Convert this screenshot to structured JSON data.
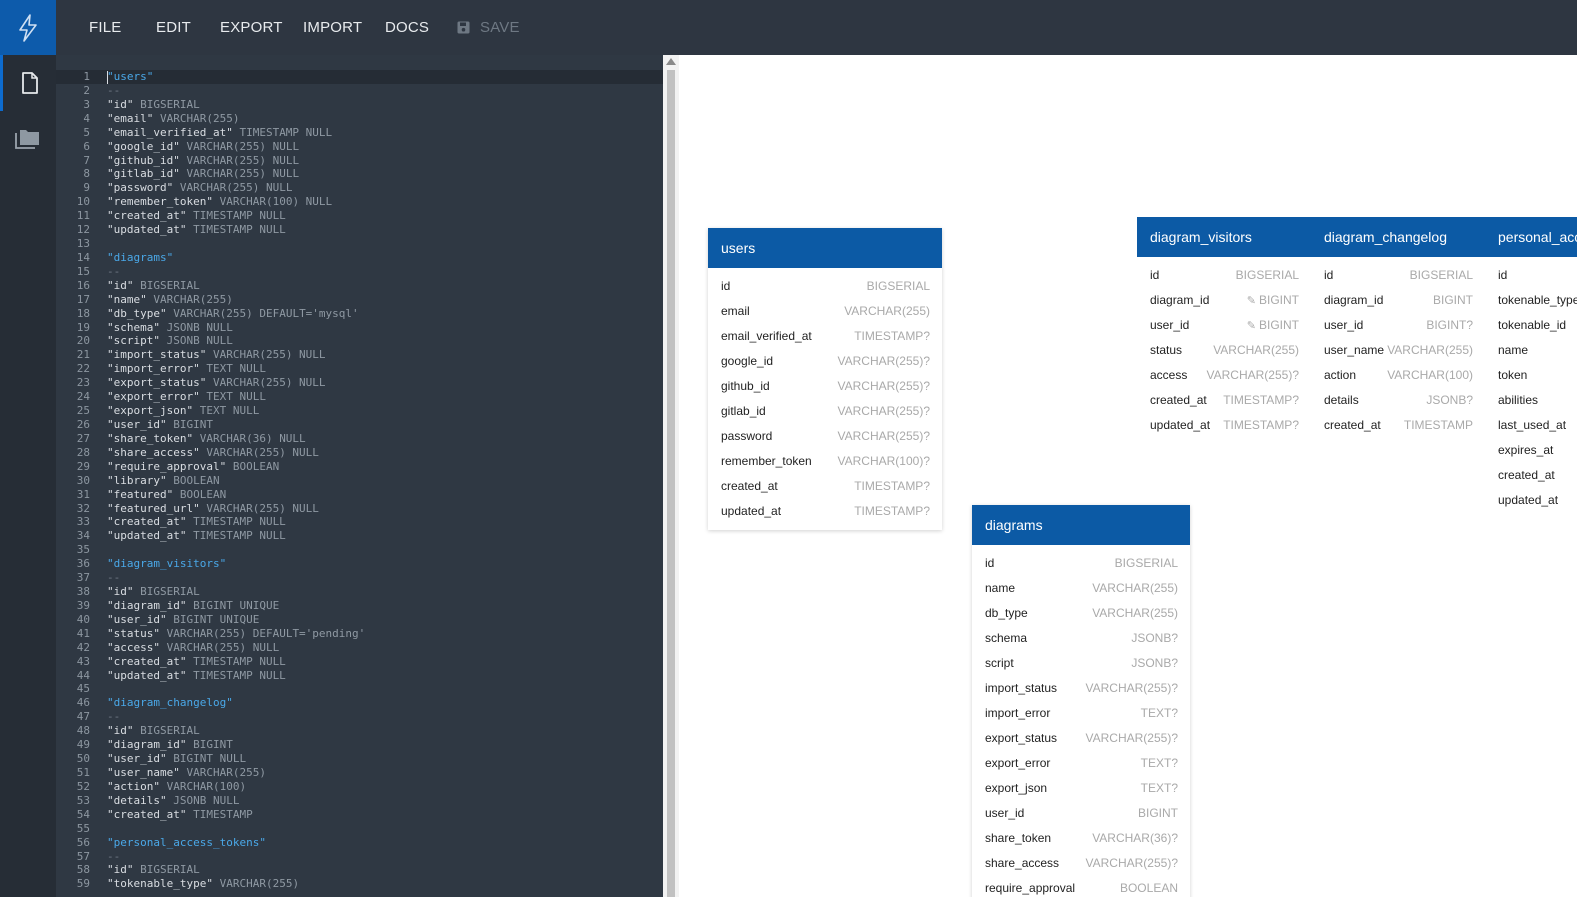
{
  "menu": {
    "file": "FILE",
    "edit": "EDIT",
    "export": "EXPORT",
    "import": "IMPORT",
    "docs": "DOCS",
    "save": "SAVE"
  },
  "sidebar": {
    "items": [
      {
        "icon": "file-icon",
        "active": true
      },
      {
        "icon": "folder-icon",
        "active": false
      }
    ]
  },
  "editor": {
    "lines": [
      [
        {
          "c": "tbl",
          "t": "\"users\""
        }
      ],
      [
        {
          "c": "dash",
          "t": "--"
        }
      ],
      [
        {
          "c": "n",
          "t": "\"id\" "
        },
        {
          "c": "t",
          "t": "BIGSERIAL"
        }
      ],
      [
        {
          "c": "n",
          "t": "\"email\" "
        },
        {
          "c": "t",
          "t": "VARCHAR(255)"
        }
      ],
      [
        {
          "c": "n",
          "t": "\"email_verified_at\" "
        },
        {
          "c": "t",
          "t": "TIMESTAMP NULL"
        }
      ],
      [
        {
          "c": "n",
          "t": "\"google_id\" "
        },
        {
          "c": "t",
          "t": "VARCHAR(255) NULL"
        }
      ],
      [
        {
          "c": "n",
          "t": "\"github_id\" "
        },
        {
          "c": "t",
          "t": "VARCHAR(255) NULL"
        }
      ],
      [
        {
          "c": "n",
          "t": "\"gitlab_id\" "
        },
        {
          "c": "t",
          "t": "VARCHAR(255) NULL"
        }
      ],
      [
        {
          "c": "n",
          "t": "\"password\" "
        },
        {
          "c": "t",
          "t": "VARCHAR(255) NULL"
        }
      ],
      [
        {
          "c": "n",
          "t": "\"remember_token\" "
        },
        {
          "c": "t",
          "t": "VARCHAR(100) NULL"
        }
      ],
      [
        {
          "c": "n",
          "t": "\"created_at\" "
        },
        {
          "c": "t",
          "t": "TIMESTAMP NULL"
        }
      ],
      [
        {
          "c": "n",
          "t": "\"updated_at\" "
        },
        {
          "c": "t",
          "t": "TIMESTAMP NULL"
        }
      ],
      [],
      [
        {
          "c": "tbl",
          "t": "\"diagrams\""
        }
      ],
      [
        {
          "c": "dash",
          "t": "--"
        }
      ],
      [
        {
          "c": "n",
          "t": "\"id\" "
        },
        {
          "c": "t",
          "t": "BIGSERIAL"
        }
      ],
      [
        {
          "c": "n",
          "t": "\"name\" "
        },
        {
          "c": "t",
          "t": "VARCHAR(255)"
        }
      ],
      [
        {
          "c": "n",
          "t": "\"db_type\" "
        },
        {
          "c": "t",
          "t": "VARCHAR(255) DEFAULT='mysql'"
        }
      ],
      [
        {
          "c": "n",
          "t": "\"schema\" "
        },
        {
          "c": "t",
          "t": "JSONB NULL"
        }
      ],
      [
        {
          "c": "n",
          "t": "\"script\" "
        },
        {
          "c": "t",
          "t": "JSONB NULL"
        }
      ],
      [
        {
          "c": "n",
          "t": "\"import_status\" "
        },
        {
          "c": "t",
          "t": "VARCHAR(255) NULL"
        }
      ],
      [
        {
          "c": "n",
          "t": "\"import_error\" "
        },
        {
          "c": "t",
          "t": "TEXT NULL"
        }
      ],
      [
        {
          "c": "n",
          "t": "\"export_status\" "
        },
        {
          "c": "t",
          "t": "VARCHAR(255) NULL"
        }
      ],
      [
        {
          "c": "n",
          "t": "\"export_error\" "
        },
        {
          "c": "t",
          "t": "TEXT NULL"
        }
      ],
      [
        {
          "c": "n",
          "t": "\"export_json\" "
        },
        {
          "c": "t",
          "t": "TEXT NULL"
        }
      ],
      [
        {
          "c": "n",
          "t": "\"user_id\" "
        },
        {
          "c": "t",
          "t": "BIGINT"
        }
      ],
      [
        {
          "c": "n",
          "t": "\"share_token\" "
        },
        {
          "c": "t",
          "t": "VARCHAR(36) NULL"
        }
      ],
      [
        {
          "c": "n",
          "t": "\"share_access\" "
        },
        {
          "c": "t",
          "t": "VARCHAR(255) NULL"
        }
      ],
      [
        {
          "c": "n",
          "t": "\"require_approval\" "
        },
        {
          "c": "t",
          "t": "BOOLEAN"
        }
      ],
      [
        {
          "c": "n",
          "t": "\"library\" "
        },
        {
          "c": "t",
          "t": "BOOLEAN"
        }
      ],
      [
        {
          "c": "n",
          "t": "\"featured\" "
        },
        {
          "c": "t",
          "t": "BOOLEAN"
        }
      ],
      [
        {
          "c": "n",
          "t": "\"featured_url\" "
        },
        {
          "c": "t",
          "t": "VARCHAR(255) NULL"
        }
      ],
      [
        {
          "c": "n",
          "t": "\"created_at\" "
        },
        {
          "c": "t",
          "t": "TIMESTAMP NULL"
        }
      ],
      [
        {
          "c": "n",
          "t": "\"updated_at\" "
        },
        {
          "c": "t",
          "t": "TIMESTAMP NULL"
        }
      ],
      [],
      [
        {
          "c": "tbl",
          "t": "\"diagram_visitors\""
        }
      ],
      [
        {
          "c": "dash",
          "t": "--"
        }
      ],
      [
        {
          "c": "n",
          "t": "\"id\" "
        },
        {
          "c": "t",
          "t": "BIGSERIAL"
        }
      ],
      [
        {
          "c": "n",
          "t": "\"diagram_id\" "
        },
        {
          "c": "t",
          "t": "BIGINT UNIQUE"
        }
      ],
      [
        {
          "c": "n",
          "t": "\"user_id\" "
        },
        {
          "c": "t",
          "t": "BIGINT UNIQUE"
        }
      ],
      [
        {
          "c": "n",
          "t": "\"status\" "
        },
        {
          "c": "t",
          "t": "VARCHAR(255) DEFAULT='pending'"
        }
      ],
      [
        {
          "c": "n",
          "t": "\"access\" "
        },
        {
          "c": "t",
          "t": "VARCHAR(255) NULL"
        }
      ],
      [
        {
          "c": "n",
          "t": "\"created_at\" "
        },
        {
          "c": "t",
          "t": "TIMESTAMP NULL"
        }
      ],
      [
        {
          "c": "n",
          "t": "\"updated_at\" "
        },
        {
          "c": "t",
          "t": "TIMESTAMP NULL"
        }
      ],
      [],
      [
        {
          "c": "tbl",
          "t": "\"diagram_changelog\""
        }
      ],
      [
        {
          "c": "dash",
          "t": "--"
        }
      ],
      [
        {
          "c": "n",
          "t": "\"id\" "
        },
        {
          "c": "t",
          "t": "BIGSERIAL"
        }
      ],
      [
        {
          "c": "n",
          "t": "\"diagram_id\" "
        },
        {
          "c": "t",
          "t": "BIGINT"
        }
      ],
      [
        {
          "c": "n",
          "t": "\"user_id\" "
        },
        {
          "c": "t",
          "t": "BIGINT NULL"
        }
      ],
      [
        {
          "c": "n",
          "t": "\"user_name\" "
        },
        {
          "c": "t",
          "t": "VARCHAR(255)"
        }
      ],
      [
        {
          "c": "n",
          "t": "\"action\" "
        },
        {
          "c": "t",
          "t": "VARCHAR(100)"
        }
      ],
      [
        {
          "c": "n",
          "t": "\"details\" "
        },
        {
          "c": "t",
          "t": "JSONB NULL"
        }
      ],
      [
        {
          "c": "n",
          "t": "\"created_at\" "
        },
        {
          "c": "t",
          "t": "TIMESTAMP"
        }
      ],
      [],
      [
        {
          "c": "tbl",
          "t": "\"personal_access_tokens\""
        }
      ],
      [
        {
          "c": "dash",
          "t": "--"
        }
      ],
      [
        {
          "c": "n",
          "t": "\"id\" "
        },
        {
          "c": "t",
          "t": "BIGSERIAL"
        }
      ],
      [
        {
          "c": "n",
          "t": "\"tokenable_type\" "
        },
        {
          "c": "t",
          "t": "VARCHAR(255)"
        }
      ]
    ]
  },
  "diagram": {
    "tables": [
      {
        "name": "users",
        "columns": [
          {
            "name": "id",
            "type": "BIGSERIAL"
          },
          {
            "name": "email",
            "type": "VARCHAR(255)"
          },
          {
            "name": "email_verified_at",
            "type": "TIMESTAMP?"
          },
          {
            "name": "google_id",
            "type": "VARCHAR(255)?"
          },
          {
            "name": "github_id",
            "type": "VARCHAR(255)?"
          },
          {
            "name": "gitlab_id",
            "type": "VARCHAR(255)?"
          },
          {
            "name": "password",
            "type": "VARCHAR(255)?"
          },
          {
            "name": "remember_token",
            "type": "VARCHAR(100)?"
          },
          {
            "name": "created_at",
            "type": "TIMESTAMP?"
          },
          {
            "name": "updated_at",
            "type": "TIMESTAMP?"
          }
        ]
      },
      {
        "name": "diagram_visitors",
        "columns": [
          {
            "name": "id",
            "type": "BIGSERIAL"
          },
          {
            "name": "diagram_id",
            "type": "BIGINT",
            "key": true
          },
          {
            "name": "user_id",
            "type": "BIGINT",
            "key": true
          },
          {
            "name": "status",
            "type": "VARCHAR(255)"
          },
          {
            "name": "access",
            "type": "VARCHAR(255)?"
          },
          {
            "name": "created_at",
            "type": "TIMESTAMP?"
          },
          {
            "name": "updated_at",
            "type": "TIMESTAMP?"
          }
        ]
      },
      {
        "name": "diagram_changelog",
        "columns": [
          {
            "name": "id",
            "type": "BIGSERIAL"
          },
          {
            "name": "diagram_id",
            "type": "BIGINT"
          },
          {
            "name": "user_id",
            "type": "BIGINT?"
          },
          {
            "name": "user_name",
            "type": "VARCHAR(255)"
          },
          {
            "name": "action",
            "type": "VARCHAR(100)"
          },
          {
            "name": "details",
            "type": "JSONB?"
          },
          {
            "name": "created_at",
            "type": "TIMESTAMP"
          }
        ]
      },
      {
        "name": "personal_access_tokens",
        "columns": [
          {
            "name": "id",
            "type": ""
          },
          {
            "name": "tokenable_type",
            "type": ""
          },
          {
            "name": "tokenable_id",
            "type": ""
          },
          {
            "name": "name",
            "type": ""
          },
          {
            "name": "token",
            "type": ""
          },
          {
            "name": "abilities",
            "type": ""
          },
          {
            "name": "last_used_at",
            "type": ""
          },
          {
            "name": "expires_at",
            "type": ""
          },
          {
            "name": "created_at",
            "type": ""
          },
          {
            "name": "updated_at",
            "type": ""
          }
        ]
      },
      {
        "name": "diagrams",
        "columns": [
          {
            "name": "id",
            "type": "BIGSERIAL"
          },
          {
            "name": "name",
            "type": "VARCHAR(255)"
          },
          {
            "name": "db_type",
            "type": "VARCHAR(255)"
          },
          {
            "name": "schema",
            "type": "JSONB?"
          },
          {
            "name": "script",
            "type": "JSONB?"
          },
          {
            "name": "import_status",
            "type": "VARCHAR(255)?"
          },
          {
            "name": "import_error",
            "type": "TEXT?"
          },
          {
            "name": "export_status",
            "type": "VARCHAR(255)?"
          },
          {
            "name": "export_error",
            "type": "TEXT?"
          },
          {
            "name": "export_json",
            "type": "TEXT?"
          },
          {
            "name": "user_id",
            "type": "BIGINT"
          },
          {
            "name": "share_token",
            "type": "VARCHAR(36)?"
          },
          {
            "name": "share_access",
            "type": "VARCHAR(255)?"
          },
          {
            "name": "require_approval",
            "type": "BOOLEAN"
          }
        ]
      }
    ]
  },
  "colors": {
    "brand": "#0d5bab",
    "table_header": "#0c5aa5",
    "editor_bg": "#2f3843",
    "table_name_code": "#4aa8e8"
  }
}
